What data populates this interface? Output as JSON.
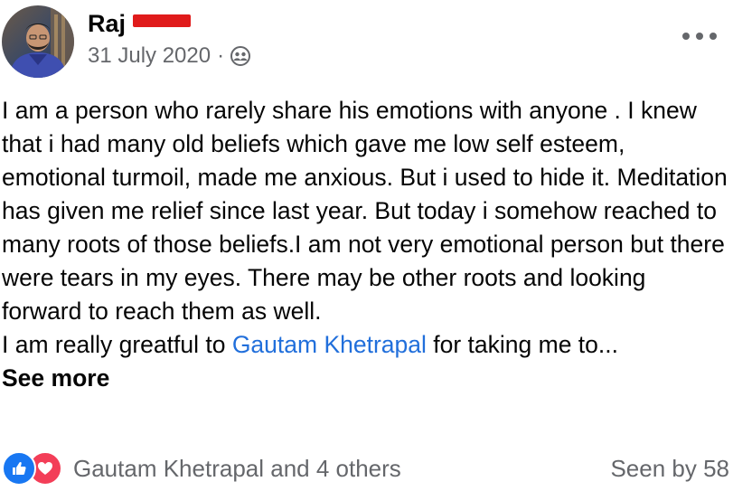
{
  "post": {
    "author": {
      "name": "Raj",
      "avatar_icon": "profile-photo"
    },
    "date": "31 July 2020",
    "separator": "·",
    "audience_icon": "friends-audience-icon",
    "menu_icon": "more-options-icon",
    "text": {
      "paragraph_1": "I am a person who rarely share his emotions with anyone . I knew that i had many old beliefs which gave me low self esteem, emotional turmoil, made me anxious. But i used to hide it. Meditation has given me relief since last year. But today i somehow reached to many roots of those beliefs.I am not very emotional person but there were tears in my eyes. There may be other roots and looking forward to reach them as well.",
      "paragraph_2_before": "I am really greatful to ",
      "mention": "Gautam Khetrapal",
      "paragraph_2_after": " for  taking me to...",
      "see_more": "See more"
    },
    "reactions": {
      "types": [
        "like",
        "love"
      ],
      "summary": "Gautam Khetrapal and 4 others"
    },
    "seen_by": "Seen by 58"
  },
  "colors": {
    "like": "#1877f2",
    "love": "#f33e58",
    "mention": "#216fdb",
    "secondary_text": "#65676b",
    "redaction": "#e01b1b"
  }
}
